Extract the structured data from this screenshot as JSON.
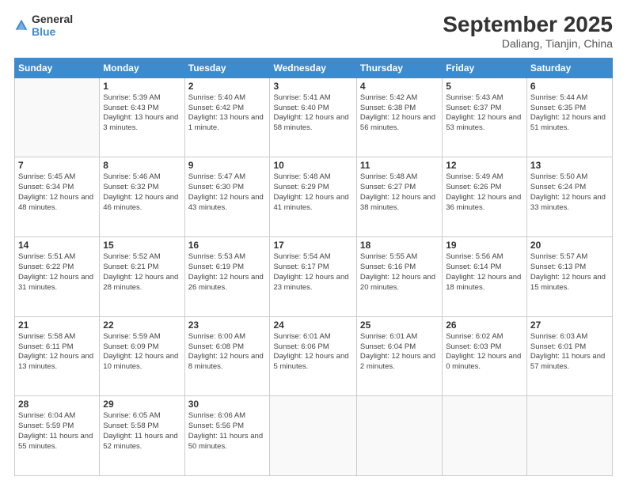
{
  "logo": {
    "general": "General",
    "blue": "Blue"
  },
  "header": {
    "month": "September 2025",
    "location": "Daliang, Tianjin, China"
  },
  "weekdays": [
    "Sunday",
    "Monday",
    "Tuesday",
    "Wednesday",
    "Thursday",
    "Friday",
    "Saturday"
  ],
  "weeks": [
    [
      {
        "day": "",
        "sunrise": "",
        "sunset": "",
        "daylight": ""
      },
      {
        "day": "1",
        "sunrise": "Sunrise: 5:39 AM",
        "sunset": "Sunset: 6:43 PM",
        "daylight": "Daylight: 13 hours and 3 minutes."
      },
      {
        "day": "2",
        "sunrise": "Sunrise: 5:40 AM",
        "sunset": "Sunset: 6:42 PM",
        "daylight": "Daylight: 13 hours and 1 minute."
      },
      {
        "day": "3",
        "sunrise": "Sunrise: 5:41 AM",
        "sunset": "Sunset: 6:40 PM",
        "daylight": "Daylight: 12 hours and 58 minutes."
      },
      {
        "day": "4",
        "sunrise": "Sunrise: 5:42 AM",
        "sunset": "Sunset: 6:38 PM",
        "daylight": "Daylight: 12 hours and 56 minutes."
      },
      {
        "day": "5",
        "sunrise": "Sunrise: 5:43 AM",
        "sunset": "Sunset: 6:37 PM",
        "daylight": "Daylight: 12 hours and 53 minutes."
      },
      {
        "day": "6",
        "sunrise": "Sunrise: 5:44 AM",
        "sunset": "Sunset: 6:35 PM",
        "daylight": "Daylight: 12 hours and 51 minutes."
      }
    ],
    [
      {
        "day": "7",
        "sunrise": "Sunrise: 5:45 AM",
        "sunset": "Sunset: 6:34 PM",
        "daylight": "Daylight: 12 hours and 48 minutes."
      },
      {
        "day": "8",
        "sunrise": "Sunrise: 5:46 AM",
        "sunset": "Sunset: 6:32 PM",
        "daylight": "Daylight: 12 hours and 46 minutes."
      },
      {
        "day": "9",
        "sunrise": "Sunrise: 5:47 AM",
        "sunset": "Sunset: 6:30 PM",
        "daylight": "Daylight: 12 hours and 43 minutes."
      },
      {
        "day": "10",
        "sunrise": "Sunrise: 5:48 AM",
        "sunset": "Sunset: 6:29 PM",
        "daylight": "Daylight: 12 hours and 41 minutes."
      },
      {
        "day": "11",
        "sunrise": "Sunrise: 5:48 AM",
        "sunset": "Sunset: 6:27 PM",
        "daylight": "Daylight: 12 hours and 38 minutes."
      },
      {
        "day": "12",
        "sunrise": "Sunrise: 5:49 AM",
        "sunset": "Sunset: 6:26 PM",
        "daylight": "Daylight: 12 hours and 36 minutes."
      },
      {
        "day": "13",
        "sunrise": "Sunrise: 5:50 AM",
        "sunset": "Sunset: 6:24 PM",
        "daylight": "Daylight: 12 hours and 33 minutes."
      }
    ],
    [
      {
        "day": "14",
        "sunrise": "Sunrise: 5:51 AM",
        "sunset": "Sunset: 6:22 PM",
        "daylight": "Daylight: 12 hours and 31 minutes."
      },
      {
        "day": "15",
        "sunrise": "Sunrise: 5:52 AM",
        "sunset": "Sunset: 6:21 PM",
        "daylight": "Daylight: 12 hours and 28 minutes."
      },
      {
        "day": "16",
        "sunrise": "Sunrise: 5:53 AM",
        "sunset": "Sunset: 6:19 PM",
        "daylight": "Daylight: 12 hours and 26 minutes."
      },
      {
        "day": "17",
        "sunrise": "Sunrise: 5:54 AM",
        "sunset": "Sunset: 6:17 PM",
        "daylight": "Daylight: 12 hours and 23 minutes."
      },
      {
        "day": "18",
        "sunrise": "Sunrise: 5:55 AM",
        "sunset": "Sunset: 6:16 PM",
        "daylight": "Daylight: 12 hours and 20 minutes."
      },
      {
        "day": "19",
        "sunrise": "Sunrise: 5:56 AM",
        "sunset": "Sunset: 6:14 PM",
        "daylight": "Daylight: 12 hours and 18 minutes."
      },
      {
        "day": "20",
        "sunrise": "Sunrise: 5:57 AM",
        "sunset": "Sunset: 6:13 PM",
        "daylight": "Daylight: 12 hours and 15 minutes."
      }
    ],
    [
      {
        "day": "21",
        "sunrise": "Sunrise: 5:58 AM",
        "sunset": "Sunset: 6:11 PM",
        "daylight": "Daylight: 12 hours and 13 minutes."
      },
      {
        "day": "22",
        "sunrise": "Sunrise: 5:59 AM",
        "sunset": "Sunset: 6:09 PM",
        "daylight": "Daylight: 12 hours and 10 minutes."
      },
      {
        "day": "23",
        "sunrise": "Sunrise: 6:00 AM",
        "sunset": "Sunset: 6:08 PM",
        "daylight": "Daylight: 12 hours and 8 minutes."
      },
      {
        "day": "24",
        "sunrise": "Sunrise: 6:01 AM",
        "sunset": "Sunset: 6:06 PM",
        "daylight": "Daylight: 12 hours and 5 minutes."
      },
      {
        "day": "25",
        "sunrise": "Sunrise: 6:01 AM",
        "sunset": "Sunset: 6:04 PM",
        "daylight": "Daylight: 12 hours and 2 minutes."
      },
      {
        "day": "26",
        "sunrise": "Sunrise: 6:02 AM",
        "sunset": "Sunset: 6:03 PM",
        "daylight": "Daylight: 12 hours and 0 minutes."
      },
      {
        "day": "27",
        "sunrise": "Sunrise: 6:03 AM",
        "sunset": "Sunset: 6:01 PM",
        "daylight": "Daylight: 11 hours and 57 minutes."
      }
    ],
    [
      {
        "day": "28",
        "sunrise": "Sunrise: 6:04 AM",
        "sunset": "Sunset: 5:59 PM",
        "daylight": "Daylight: 11 hours and 55 minutes."
      },
      {
        "day": "29",
        "sunrise": "Sunrise: 6:05 AM",
        "sunset": "Sunset: 5:58 PM",
        "daylight": "Daylight: 11 hours and 52 minutes."
      },
      {
        "day": "30",
        "sunrise": "Sunrise: 6:06 AM",
        "sunset": "Sunset: 5:56 PM",
        "daylight": "Daylight: 11 hours and 50 minutes."
      },
      {
        "day": "",
        "sunrise": "",
        "sunset": "",
        "daylight": ""
      },
      {
        "day": "",
        "sunrise": "",
        "sunset": "",
        "daylight": ""
      },
      {
        "day": "",
        "sunrise": "",
        "sunset": "",
        "daylight": ""
      },
      {
        "day": "",
        "sunrise": "",
        "sunset": "",
        "daylight": ""
      }
    ]
  ]
}
